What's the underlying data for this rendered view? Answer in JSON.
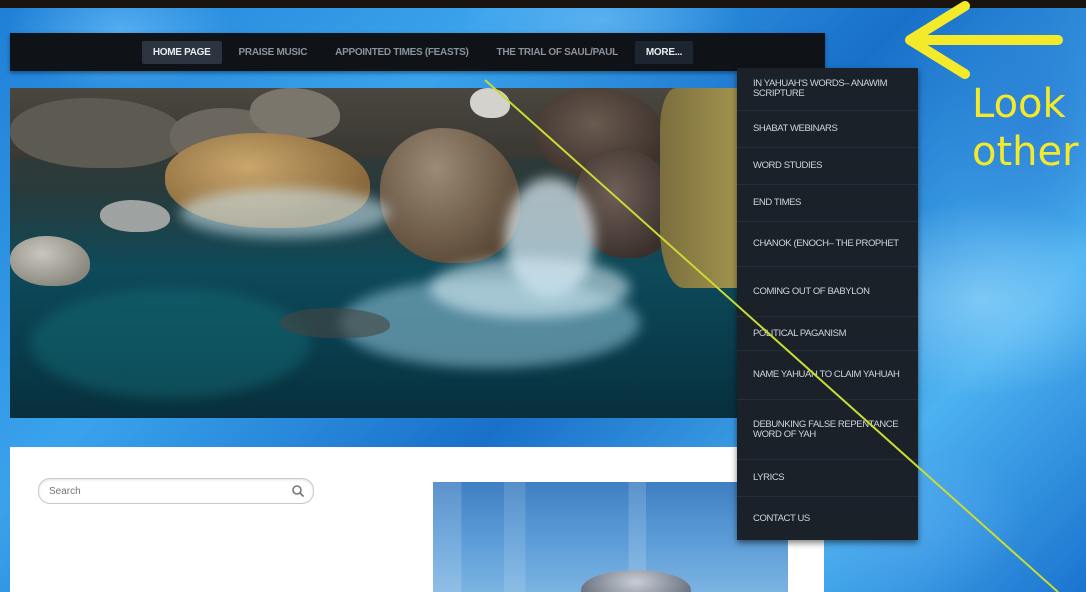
{
  "nav": {
    "items": [
      {
        "label": "HOME PAGE",
        "active": true
      },
      {
        "label": "PRAISE MUSIC",
        "active": false
      },
      {
        "label": "APPOINTED TIMES (FEASTS)",
        "active": false
      },
      {
        "label": "THE TRIAL OF SAUL/PAUL",
        "active": false
      },
      {
        "label": "MORE...",
        "active": false
      }
    ]
  },
  "dropdown": {
    "items": [
      {
        "label": "IN YAHUAH'S WORDS– ANAWIM SCRIPTURE"
      },
      {
        "label": "SHABAT WEBINARS"
      },
      {
        "label": "WORD STUDIES"
      },
      {
        "label": "END TIMES"
      },
      {
        "label": "CHANOK (ENOCH– THE PROPHET"
      },
      {
        "label": "COMING OUT OF BABYLON"
      },
      {
        "label": "POLITICAL PAGANISM"
      },
      {
        "label": "NAME YAHUAH TO CLAIM YAHUAH"
      },
      {
        "label": "DEBUNKING FALSE REPENTANCE WORD OF YAH"
      },
      {
        "label": "LYRICS"
      },
      {
        "label": "CONTACT US"
      }
    ]
  },
  "search": {
    "placeholder": "Search"
  },
  "annotation": {
    "text": "Look\nother",
    "color": "#f4ea2a"
  },
  "colors": {
    "nav_bg": "#0f1318",
    "dropdown_bg": "#1a2129",
    "annotation": "#f4ea2a"
  }
}
